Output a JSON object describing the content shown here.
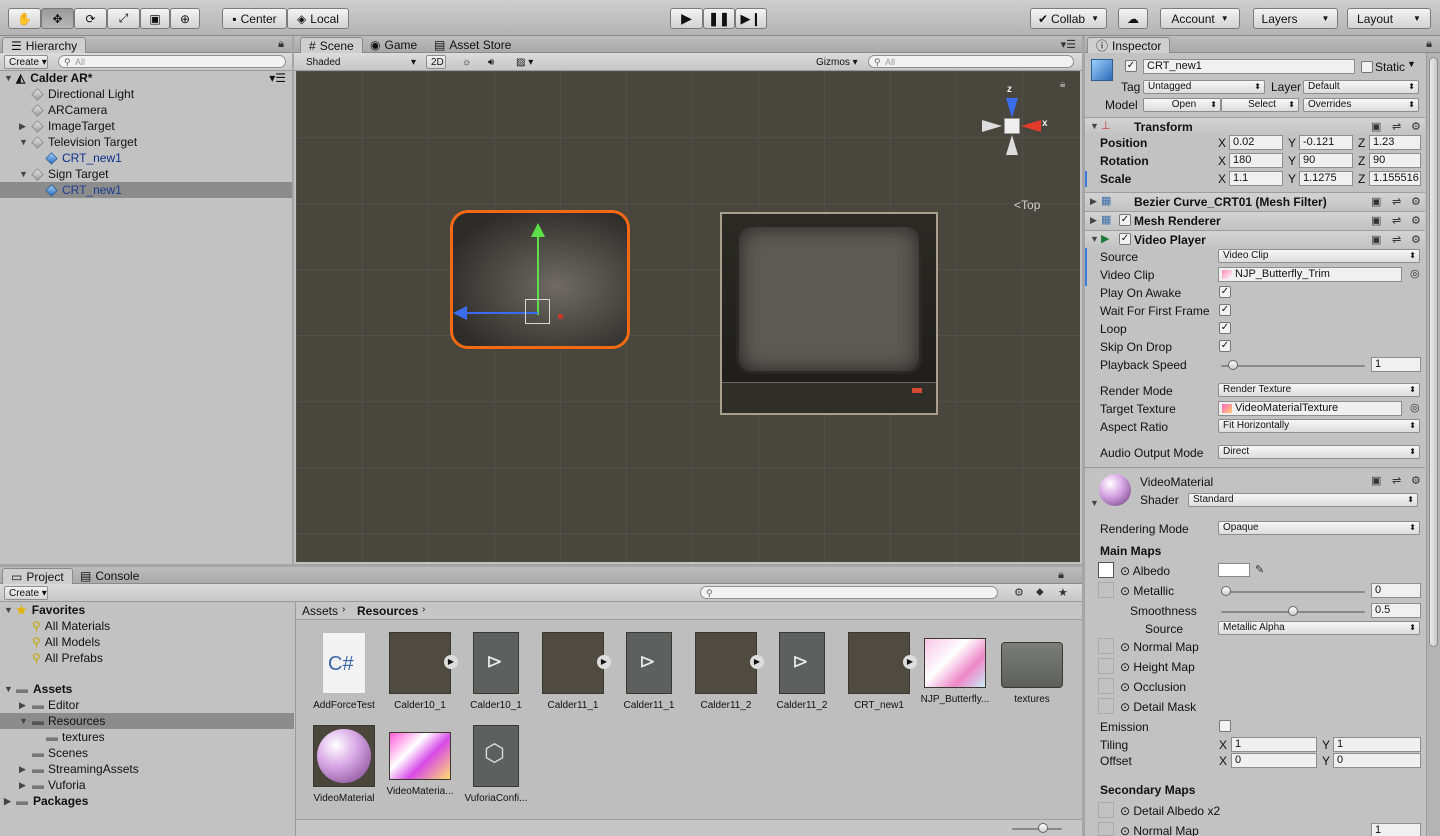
{
  "toolbar": {
    "pivot": "Center",
    "space": "Local",
    "collab": "Collab",
    "account": "Account",
    "layers": "Layers",
    "layout": "Layout"
  },
  "hierarchy": {
    "tab": "Hierarchy",
    "create": "Create",
    "search_placeholder": "All",
    "scene": "Calder AR*",
    "items": [
      "Directional Light",
      "ARCamera",
      "ImageTarget",
      "Television Target",
      "CRT_new1",
      "Sign Target",
      "CRT_new1"
    ]
  },
  "scene": {
    "tabs": [
      "Scene",
      "Game",
      "Asset Store"
    ],
    "shading": "Shaded",
    "mode2d": "2D",
    "gizmos": "Gizmos",
    "search_placeholder": "All",
    "view_label": "Top",
    "axis_x": "x",
    "axis_z": "z"
  },
  "project": {
    "tabs": [
      "Project",
      "Console"
    ],
    "create": "Create",
    "favorites": "Favorites",
    "fav_items": [
      "All Materials",
      "All Models",
      "All Prefabs"
    ],
    "assets": "Assets",
    "asset_folders": [
      "Editor",
      "Resources",
      "textures",
      "Scenes",
      "StreamingAssets",
      "Vuforia"
    ],
    "packages": "Packages",
    "breadcrumb": [
      "Assets",
      "Resources"
    ],
    "grid": [
      "AddForceTest",
      "Calder10_1",
      "Calder10_1",
      "Calder11_1",
      "Calder11_1",
      "Calder11_2",
      "Calder11_2",
      "CRT_new1",
      "NJP_Butterfly...",
      "textures",
      "VideoMaterial",
      "VideoMateria...",
      "VuforiaConfi..."
    ],
    "cs_glyph": "C#"
  },
  "inspector": {
    "tab": "Inspector",
    "name": "CRT_new1",
    "static": "Static",
    "tag_label": "Tag",
    "tag": "Untagged",
    "layer_label": "Layer",
    "layer": "Default",
    "model_label": "Model",
    "open": "Open",
    "select": "Select",
    "overrides": "Overrides",
    "transform": {
      "title": "Transform",
      "position": "Position",
      "rotation": "Rotation",
      "scale": "Scale",
      "x": "X",
      "y": "Y",
      "z": "Z",
      "pos": [
        "0.02",
        "-0.121",
        "1.23"
      ],
      "rot": [
        "180",
        "90",
        "90"
      ],
      "scl": [
        "1.1",
        "1.1275",
        "1.155516"
      ]
    },
    "mesh_filter": "Bezier Curve_CRT01 (Mesh Filter)",
    "mesh_renderer": "Mesh Renderer",
    "video": {
      "title": "Video Player",
      "source_l": "Source",
      "source": "Video Clip",
      "clip_l": "Video Clip",
      "clip": "NJP_Butterfly_Trim",
      "awake_l": "Play On Awake",
      "wait_l": "Wait For First Frame",
      "loop_l": "Loop",
      "skip_l": "Skip On Drop",
      "speed_l": "Playback Speed",
      "speed": "1",
      "speed_fraction": 0.05,
      "render_l": "Render Mode",
      "render": "Render Texture",
      "target_l": "Target Texture",
      "target": "VideoMaterialTexture",
      "aspect_l": "Aspect Ratio",
      "aspect": "Fit Horizontally",
      "audio_l": "Audio Output Mode",
      "audio": "Direct"
    },
    "material": {
      "name": "VideoMaterial",
      "shader_l": "Shader",
      "shader": "Standard",
      "rendering_l": "Rendering Mode",
      "rendering": "Opaque",
      "main_maps": "Main Maps",
      "albedo": "Albedo",
      "metallic": "Metallic",
      "metallic_v": "0",
      "metallic_fraction": 0,
      "smooth": "Smoothness",
      "smooth_v": "0.5",
      "smooth_fraction": 0.5,
      "source_l": "Source",
      "source": "Metallic Alpha",
      "normal": "Normal Map",
      "height": "Height Map",
      "occlusion": "Occlusion",
      "detail": "Detail Mask",
      "emission": "Emission",
      "tiling": "Tiling",
      "offset": "Offset",
      "x": "X",
      "y": "Y",
      "tiling_v": [
        "1",
        "1"
      ],
      "offset_v": [
        "0",
        "0"
      ],
      "secondary": "Secondary Maps",
      "detail_albedo": "Detail Albedo x2",
      "normal2": "Normal Map",
      "normal2_v": "1"
    }
  }
}
